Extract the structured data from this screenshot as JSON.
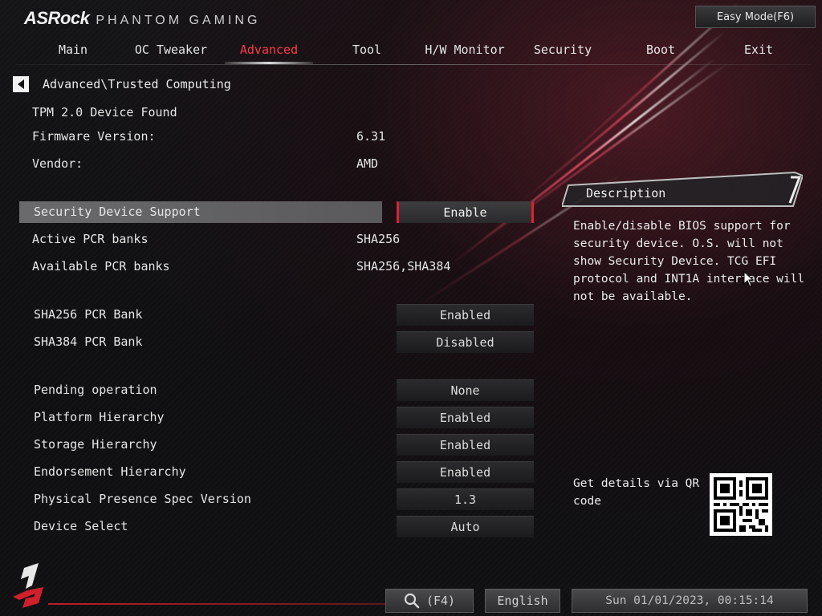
{
  "header": {
    "brand": "ASRock",
    "sub_brand": "PHANTOM GAMING",
    "easy_mode": "Easy Mode(F6)"
  },
  "tabs": [
    {
      "label": "Main"
    },
    {
      "label": "OC Tweaker"
    },
    {
      "label": "Advanced",
      "active": true
    },
    {
      "label": "Tool"
    },
    {
      "label": "H/W Monitor"
    },
    {
      "label": "Security"
    },
    {
      "label": "Boot"
    },
    {
      "label": "Exit"
    }
  ],
  "breadcrumb": "Advanced\\Trusted Computing",
  "info": {
    "tpm_found": "TPM 2.0 Device Found",
    "firmware_label": "Firmware Version:",
    "firmware_value": "6.31",
    "vendor_label": "Vendor:",
    "vendor_value": "AMD",
    "active_pcr_label": "Active PCR banks",
    "active_pcr_value": "SHA256",
    "available_pcr_label": "Available PCR banks",
    "available_pcr_value": "SHA256,SHA384"
  },
  "settings": {
    "security_device_support": {
      "label": "Security Device Support",
      "value": "Enable"
    },
    "sha256_pcr_bank": {
      "label": "SHA256 PCR Bank",
      "value": "Enabled"
    },
    "sha384_pcr_bank": {
      "label": "SHA384 PCR Bank",
      "value": "Disabled"
    },
    "pending_operation": {
      "label": "Pending operation",
      "value": "None"
    },
    "platform_hierarchy": {
      "label": "Platform Hierarchy",
      "value": "Enabled"
    },
    "storage_hierarchy": {
      "label": "Storage Hierarchy",
      "value": "Enabled"
    },
    "endorsement_hierarchy": {
      "label": "Endorsement Hierarchy",
      "value": "Enabled"
    },
    "pp_spec_version": {
      "label": "Physical Presence Spec Version",
      "value": "1.3"
    },
    "device_select": {
      "label": "Device Select",
      "value": "Auto"
    }
  },
  "description": {
    "title": "Description",
    "text": "Enable/disable BIOS support for security device. O.S. will not show Security Device. TCG EFI protocol and INT1A interface will not be available."
  },
  "qr": {
    "text": "Get details via QR code"
  },
  "footer": {
    "search_key": "(F4)",
    "language": "English",
    "datetime": "Sun 01/01/2023, 00:15:14"
  },
  "colors": {
    "accent": "#e0202e",
    "active_tab": "#ff3a46",
    "highlight_row": "#6a6a6c"
  },
  "icons": [
    "back-arrow-icon",
    "search-icon",
    "pointer-cursor-icon",
    "phantom-gaming-logo-icon",
    "qr-code"
  ]
}
